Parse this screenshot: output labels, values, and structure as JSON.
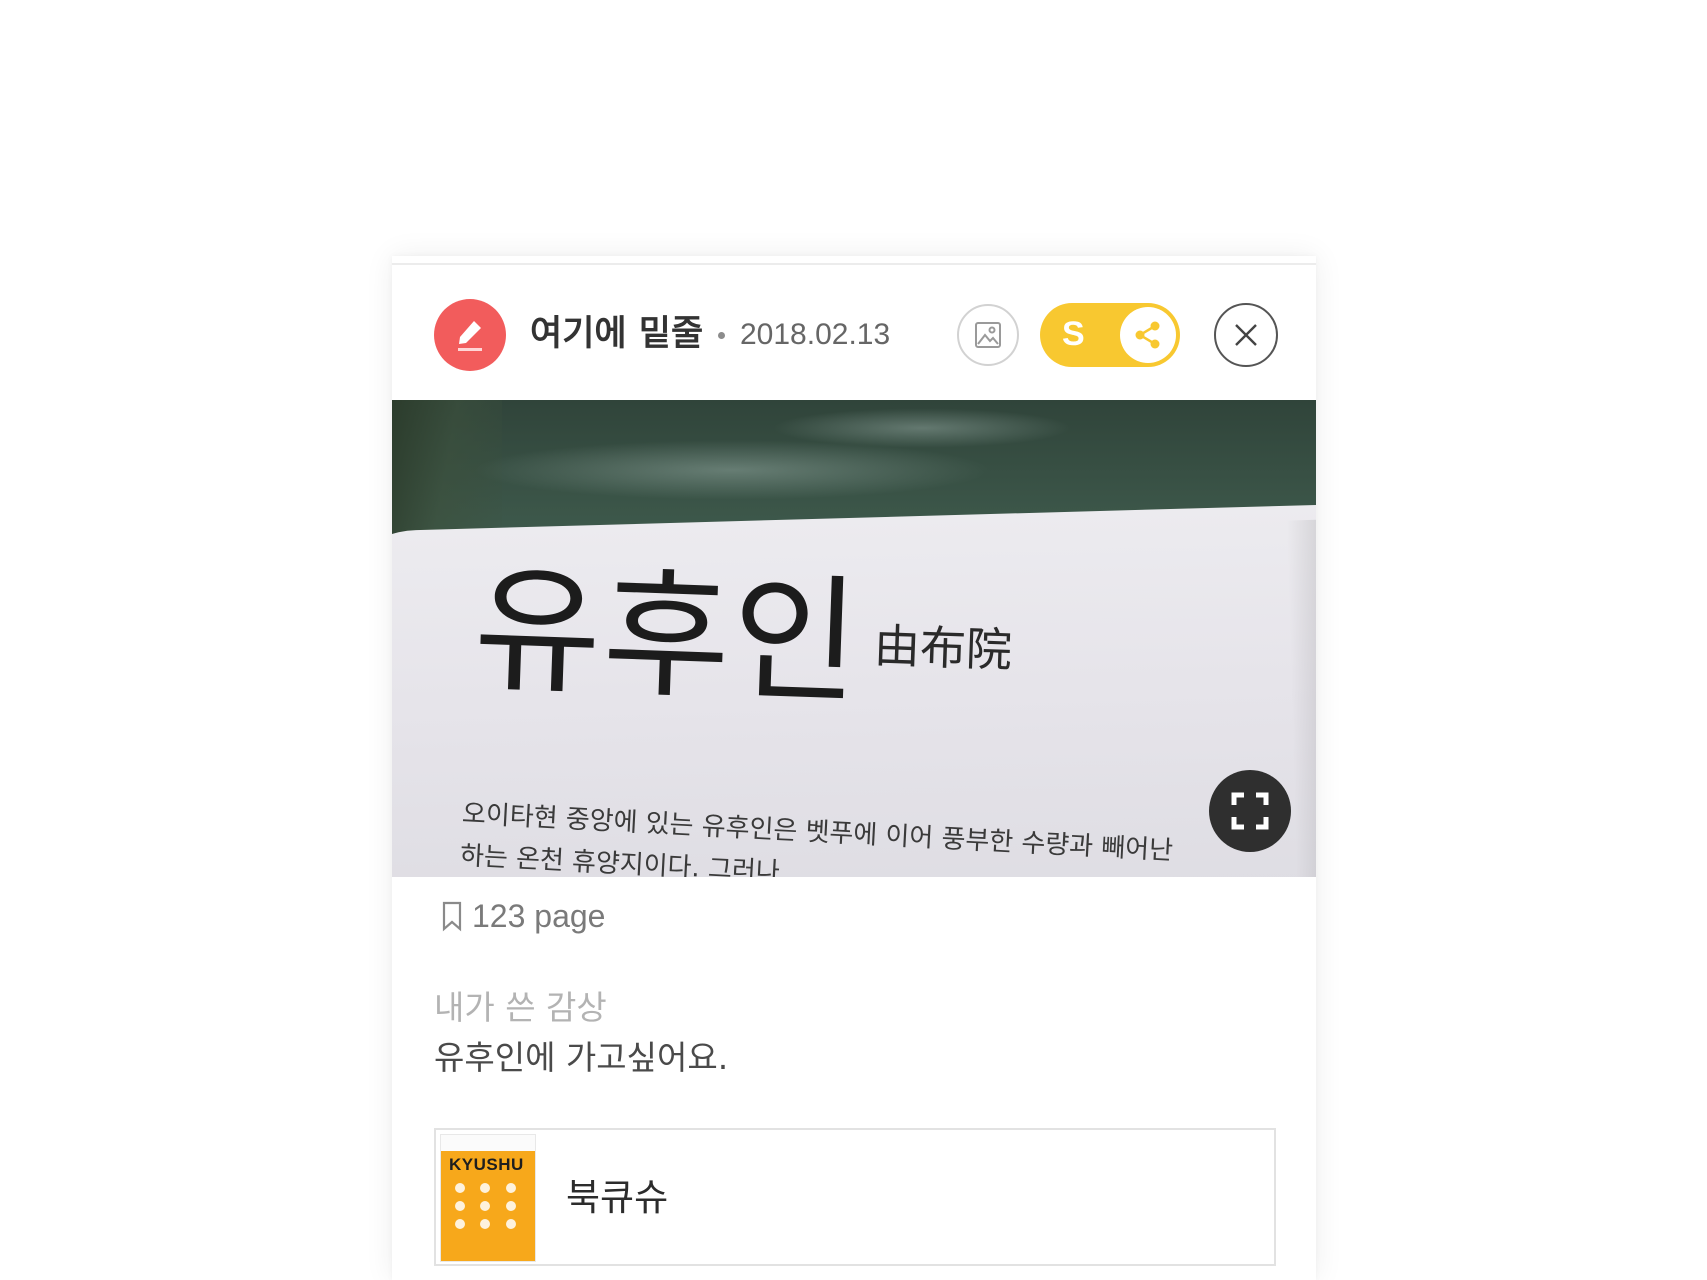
{
  "header": {
    "title": "여기에 밑줄",
    "date": "2018.02.13",
    "share_toggle_label": "S"
  },
  "photo": {
    "headline": "유후인",
    "headline_kanji": "由布院",
    "body_lines": [
      "오이타현 중앙에 있는 유후인은 벳푸에 이어 풍부한 수량과 빼어난",
      "하는 온천 휴양지이다. 그러나"
    ]
  },
  "page_ref": {
    "text": "123 page"
  },
  "review": {
    "label": "내가 쓴 감상",
    "text": "유후인에 가고싶어요."
  },
  "book": {
    "cover_title": "KYUSHU",
    "title": "북큐슈"
  },
  "colors": {
    "pen_badge": "#f25c5c",
    "share_toggle": "#f8c830",
    "expand_button": "#2f2f2f",
    "book_cover": "#f7a81b"
  },
  "icons": {
    "pen": "pen-icon",
    "image": "image-icon",
    "share": "share-icon",
    "close": "close-icon",
    "expand": "expand-icon",
    "bookmark": "bookmark-icon"
  }
}
